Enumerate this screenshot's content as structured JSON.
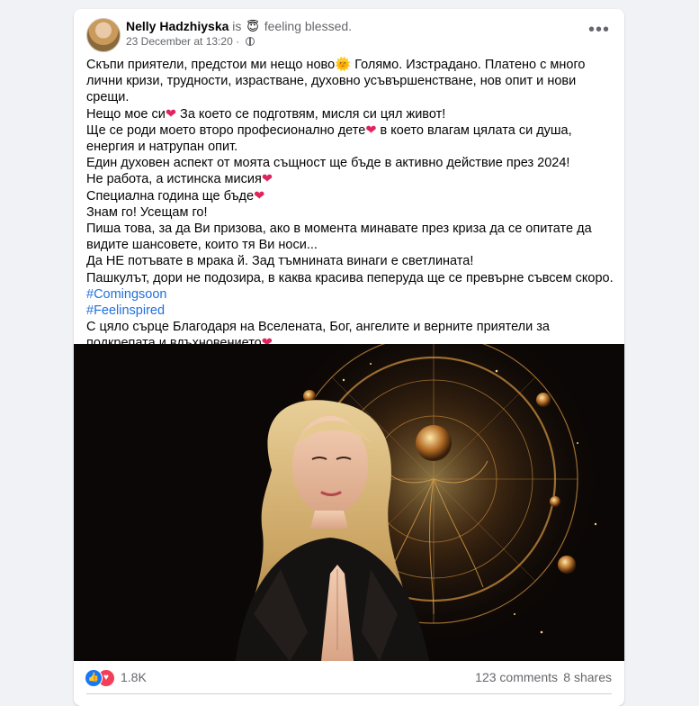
{
  "post": {
    "author": "Nelly Hadzhiyska",
    "is_word": "is",
    "feeling_emoji": "😇",
    "feeling_text": "feeling blessed.",
    "timestamp": "23 December at 13:20",
    "separator": "·",
    "audience_icon": "globe-icon",
    "more_icon": "more-horizontal-icon"
  },
  "text": {
    "line1a": "Скъпи приятели, предстои ми нещо ново",
    "sun": "🌞",
    "line1b": " Голямо. Изстрадано. Платено с много лични кризи,  трудности, израстване, духовно усъвършенстване, нов опит и нови срещи.",
    "line2a": " Нещо мое си",
    "line2b": " За което се подготвям, мисля си цял живот!",
    "line3a": "Ще се роди моето второ професионално дете",
    "line3b": " в което влагам цялата си душа, енергия и натрупан опит.",
    "line4": "Един духовен аспект от моята същност ще бъде в активно действие през 2024!",
    "line5": "Не работа, а истинска мисия",
    "line6": "Специална година ще бъде",
    "line7": "Знам го! Усещам го!",
    "line8": "Пиша това, за да Ви призова, ако в момента минавате през криза да се опитате да видите шансовете, които тя Ви носи...",
    "line9": " Да НЕ потъвате в мрака й. Зад тъмнината винаги е светлината!",
    "line10": "Пашкулът, дори не подозира, в каква красива пеперуда ще се превърне съвсем скоро.",
    "hashtag1": "#Comingsoon",
    "hashtag2": "#Feelinspired",
    "line11": "С цяло сърце Благодаря на Вселената, Бог,  ангелите и верните приятели за подкрепата и вдъхновението",
    "heart": "❤"
  },
  "stats": {
    "reactions": "1.8K",
    "comments": "123 comments",
    "shares": "8 shares",
    "like_icon": "👍",
    "love_icon": "♥"
  },
  "colors": {
    "link": "#216fdb",
    "heart": "#e0245e",
    "like": "#1877f2",
    "love": "#f33e58"
  }
}
